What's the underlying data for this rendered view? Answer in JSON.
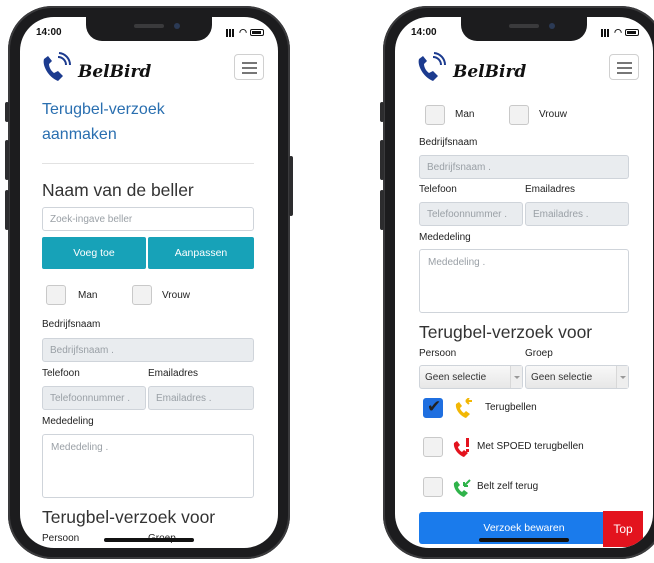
{
  "status_bar": {
    "time": "14:00"
  },
  "brand": {
    "name": "BelBird"
  },
  "form": {
    "title": "Terugbel-verzoek aanmaken",
    "caller_section": "Naam van de beller",
    "search_placeholder": "Zoek-ingave beller",
    "add_button": "Voeg toe",
    "edit_button": "Aanpassen",
    "gender_male": "Man",
    "gender_female": "Vrouw",
    "company_label": "Bedrijfsnaam",
    "company_placeholder": "Bedrijfsnaam .",
    "phone_label": "Telefoon",
    "phone_placeholder": "Telefoonnummer .",
    "email_label": "Emailadres",
    "email_placeholder": "Emailadres .",
    "message_label": "Mededeling",
    "message_placeholder": "Mededeling .",
    "request_section": "Terugbel-verzoek voor",
    "person_label": "Persoon",
    "group_label": "Groep",
    "person_select": "Geen selectie",
    "group_select": "Geen selectie",
    "options": [
      {
        "label": "Terugbellen",
        "checked": true,
        "icon": "phone-callback-icon",
        "color": "#f2b705"
      },
      {
        "label": "Met SPOED terugbellen",
        "checked": false,
        "icon": "phone-urgent-icon",
        "color": "#e3131e"
      },
      {
        "label": "Belt zelf terug",
        "checked": false,
        "icon": "phone-incoming-icon",
        "color": "#2fb34a"
      }
    ],
    "save_button": "Verzoek bewaren",
    "top_button": "Top"
  },
  "colors": {
    "accent": "#17a2b8",
    "link": "#2a6fb0",
    "primary": "#1a7bec",
    "danger": "#e3131e"
  }
}
